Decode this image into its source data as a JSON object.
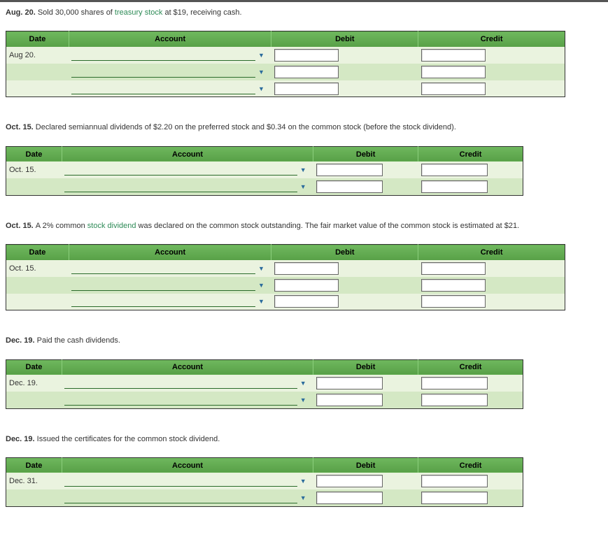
{
  "headers": {
    "date": "Date",
    "account": "Account",
    "debit": "Debit",
    "credit": "Credit"
  },
  "sections": [
    {
      "prompt_prefix": "Aug. 20.",
      "prompt_parts": [
        "Sold 30,000 shares of ",
        "treasury stock",
        " at $19, receiving cash."
      ],
      "link_index": 1,
      "layout": "A",
      "rows": [
        {
          "date": "Aug 20.",
          "shade": "light"
        },
        {
          "date": "",
          "shade": "dark"
        },
        {
          "date": "",
          "shade": "light"
        }
      ]
    },
    {
      "prompt_prefix": "Oct. 15.",
      "prompt_parts": [
        "Declared semiannual dividends of $2.20 on the preferred stock and $0.34 on the common stock (before the stock dividend)."
      ],
      "link_index": -1,
      "layout": "B",
      "rows": [
        {
          "date": "Oct. 15.",
          "shade": "light"
        },
        {
          "date": "",
          "shade": "dark"
        }
      ]
    },
    {
      "prompt_prefix": "Oct. 15.",
      "prompt_parts": [
        "A 2% common ",
        "stock dividend",
        " was declared on the common stock outstanding. The fair market value of the common stock is estimated at $21."
      ],
      "link_index": 1,
      "layout": "A",
      "rows": [
        {
          "date": "Oct. 15.",
          "shade": "light"
        },
        {
          "date": "",
          "shade": "dark"
        },
        {
          "date": "",
          "shade": "light"
        }
      ]
    },
    {
      "prompt_prefix": "Dec. 19.",
      "prompt_parts": [
        "Paid the cash dividends."
      ],
      "link_index": -1,
      "layout": "B",
      "rows": [
        {
          "date": "Dec. 19.",
          "shade": "light"
        },
        {
          "date": "",
          "shade": "dark"
        }
      ]
    },
    {
      "prompt_prefix": "Dec. 19.",
      "prompt_parts": [
        "Issued the certificates for the common stock dividend."
      ],
      "link_index": -1,
      "layout": "B",
      "rows": [
        {
          "date": "Dec. 31.",
          "shade": "light"
        },
        {
          "date": "",
          "shade": "dark"
        }
      ]
    }
  ]
}
